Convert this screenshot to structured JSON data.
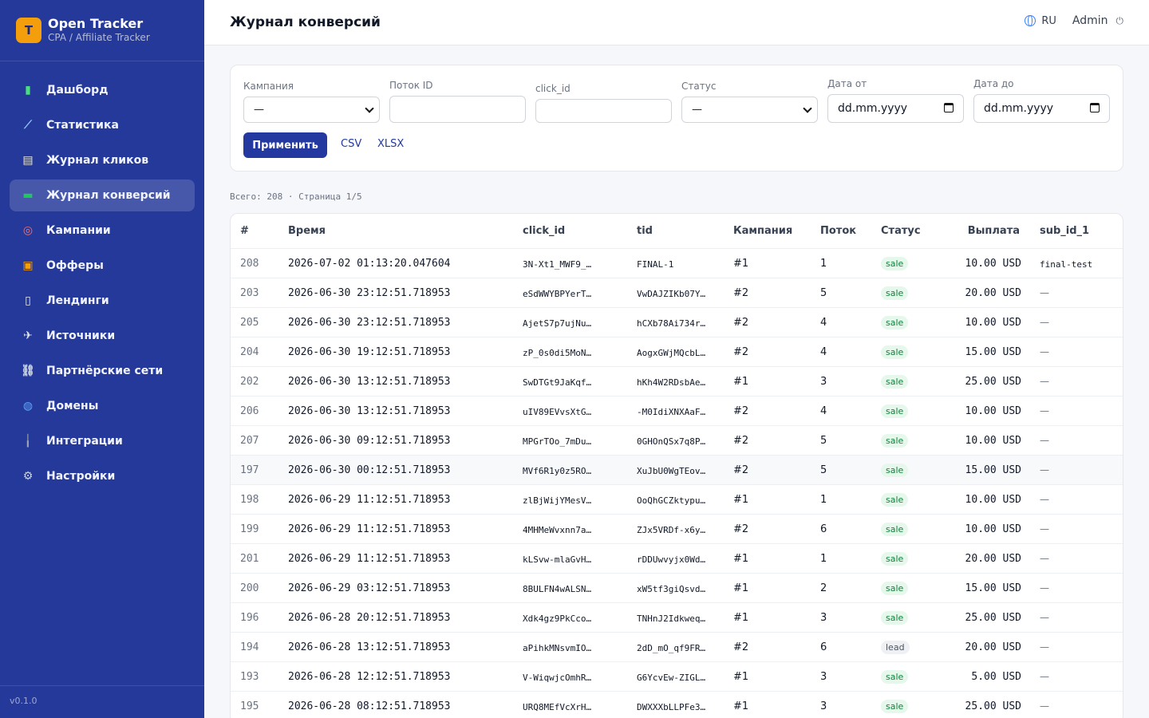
{
  "brand": {
    "logo": "T",
    "title": "Open Tracker",
    "subtitle": "CPA / Affiliate Tracker"
  },
  "sidebar": {
    "items": [
      {
        "label": "Дашборд",
        "icon": "chart-bar-icon",
        "color": "#4ade80"
      },
      {
        "label": "Статистика",
        "icon": "chart-line-icon",
        "color": "#93c5fd"
      },
      {
        "label": "Журнал кликов",
        "icon": "clipboard-icon",
        "color": "#e5e7eb"
      },
      {
        "label": "Журнал конверсий",
        "icon": "money-icon",
        "color": "#22c55e",
        "active": true
      },
      {
        "label": "Кампании",
        "icon": "target-icon",
        "color": "#f87171"
      },
      {
        "label": "Офферы",
        "icon": "gift-icon",
        "color": "#f59e0b"
      },
      {
        "label": "Лендинги",
        "icon": "page-icon",
        "color": "#e5e7eb"
      },
      {
        "label": "Источники",
        "icon": "airplane-icon",
        "color": "#e5e7eb"
      },
      {
        "label": "Партнёрские сети",
        "icon": "link-icon",
        "color": "#cbd5e1"
      },
      {
        "label": "Домены",
        "icon": "globe-icon",
        "color": "#60a5fa"
      },
      {
        "label": "Интеграции",
        "icon": "plug-icon",
        "color": "#9ca3af"
      },
      {
        "label": "Настройки",
        "icon": "gear-icon",
        "color": "#cbd5e1"
      }
    ],
    "version": "v0.1.0"
  },
  "header": {
    "title": "Журнал конверсий",
    "lang": "RU",
    "user": "Admin"
  },
  "filters": {
    "campaign_label": "Кампания",
    "campaign_value": "—",
    "flow_label": "Поток ID",
    "flow_value": "",
    "click_label": "click_id",
    "click_value": "",
    "status_label": "Статус",
    "status_value": "—",
    "date_from_label": "Дата от",
    "date_from_value": "dd.mm.yyyy",
    "date_to_label": "Дата до",
    "date_to_value": "dd.mm.yyyy",
    "apply": "Применить",
    "csv": "CSV",
    "xlsx": "XLSX"
  },
  "summary": "Всего: 208 · Страница 1/5",
  "table": {
    "columns": [
      "#",
      "Время",
      "click_id",
      "tid",
      "Кампания",
      "Поток",
      "Статус",
      "Выплата",
      "sub_id_1"
    ],
    "rows": [
      {
        "id": "208",
        "time": "2026-07-02 01:13:20.047604",
        "click_id": "3N-Xt1_MWF9_…",
        "tid": "FINAL-1",
        "campaign": "#1",
        "flow": "1",
        "status": "sale",
        "payout": "10.00 USD",
        "sub1": "final-test"
      },
      {
        "id": "203",
        "time": "2026-06-30 23:12:51.718953",
        "click_id": "eSdWWYBPYerT…",
        "tid": "VwDAJZIKb07Y…",
        "campaign": "#2",
        "flow": "5",
        "status": "sale",
        "payout": "20.00 USD",
        "sub1": "—"
      },
      {
        "id": "205",
        "time": "2026-06-30 23:12:51.718953",
        "click_id": "AjetS7p7ujNu…",
        "tid": "hCXb78Ai734r…",
        "campaign": "#2",
        "flow": "4",
        "status": "sale",
        "payout": "10.00 USD",
        "sub1": "—"
      },
      {
        "id": "204",
        "time": "2026-06-30 19:12:51.718953",
        "click_id": "zP_0s0di5MoN…",
        "tid": "AogxGWjMQcbL…",
        "campaign": "#2",
        "flow": "4",
        "status": "sale",
        "payout": "15.00 USD",
        "sub1": "—"
      },
      {
        "id": "202",
        "time": "2026-06-30 13:12:51.718953",
        "click_id": "SwDTGt9JaKqf…",
        "tid": "hKh4W2RDsbAe…",
        "campaign": "#1",
        "flow": "3",
        "status": "sale",
        "payout": "25.00 USD",
        "sub1": "—"
      },
      {
        "id": "206",
        "time": "2026-06-30 13:12:51.718953",
        "click_id": "uIV89EVvsXtG…",
        "tid": "-M0IdiXNXAaF…",
        "campaign": "#2",
        "flow": "4",
        "status": "sale",
        "payout": "10.00 USD",
        "sub1": "—"
      },
      {
        "id": "207",
        "time": "2026-06-30 09:12:51.718953",
        "click_id": "MPGrTOo_7mDu…",
        "tid": "0GHOnQSx7q8P…",
        "campaign": "#2",
        "flow": "5",
        "status": "sale",
        "payout": "10.00 USD",
        "sub1": "—"
      },
      {
        "id": "197",
        "time": "2026-06-30 00:12:51.718953",
        "click_id": "MVf6R1y0z5RO…",
        "tid": "XuJbU0WgTEov…",
        "campaign": "#2",
        "flow": "5",
        "status": "sale",
        "payout": "15.00 USD",
        "sub1": "—"
      },
      {
        "id": "198",
        "time": "2026-06-29 11:12:51.718953",
        "click_id": "zlBjWijYMesV…",
        "tid": "OoQhGCZktypu…",
        "campaign": "#1",
        "flow": "1",
        "status": "sale",
        "payout": "10.00 USD",
        "sub1": "—"
      },
      {
        "id": "199",
        "time": "2026-06-29 11:12:51.718953",
        "click_id": "4MHMeWvxnn7a…",
        "tid": "ZJx5VRDf-x6y…",
        "campaign": "#2",
        "flow": "6",
        "status": "sale",
        "payout": "10.00 USD",
        "sub1": "—"
      },
      {
        "id": "201",
        "time": "2026-06-29 11:12:51.718953",
        "click_id": "kLSvw-mlaGvH…",
        "tid": "rDDUwvyjx0Wd…",
        "campaign": "#1",
        "flow": "1",
        "status": "sale",
        "payout": "20.00 USD",
        "sub1": "—"
      },
      {
        "id": "200",
        "time": "2026-06-29 03:12:51.718953",
        "click_id": "8BULFN4wALSN…",
        "tid": "xW5tf3giQsvd…",
        "campaign": "#1",
        "flow": "2",
        "status": "sale",
        "payout": "15.00 USD",
        "sub1": "—"
      },
      {
        "id": "196",
        "time": "2026-06-28 20:12:51.718953",
        "click_id": "Xdk4gz9PkCco…",
        "tid": "TNHnJ2Idkweq…",
        "campaign": "#1",
        "flow": "3",
        "status": "sale",
        "payout": "25.00 USD",
        "sub1": "—"
      },
      {
        "id": "194",
        "time": "2026-06-28 13:12:51.718953",
        "click_id": "aPihkMNsvmIO…",
        "tid": "2dD_mO_qf9FR…",
        "campaign": "#2",
        "flow": "6",
        "status": "lead",
        "payout": "20.00 USD",
        "sub1": "—"
      },
      {
        "id": "193",
        "time": "2026-06-28 12:12:51.718953",
        "click_id": "V-WiqwjcOmhR…",
        "tid": "G6YcvEw-ZIGL…",
        "campaign": "#1",
        "flow": "3",
        "status": "sale",
        "payout": "5.00 USD",
        "sub1": "—"
      },
      {
        "id": "195",
        "time": "2026-06-28 08:12:51.718953",
        "click_id": "URQ8MEfVcXrH…",
        "tid": "DWXXXbLLPFe3…",
        "campaign": "#1",
        "flow": "3",
        "status": "sale",
        "payout": "25.00 USD",
        "sub1": "—"
      }
    ]
  }
}
